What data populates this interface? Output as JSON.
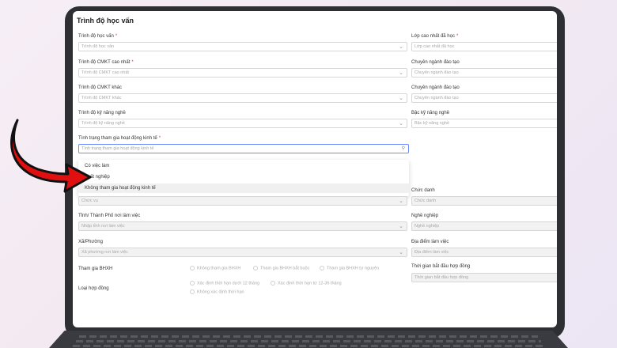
{
  "section_title": "Trình độ học vấn",
  "fields": {
    "trinh_do_hoc_van": {
      "label": "Trình độ học vấn",
      "placeholder": "Trình độ học vấn",
      "required": "*"
    },
    "lop_cao_nhat": {
      "label": "Lớp cao nhất đã học",
      "placeholder": "Lớp cao nhất đã học",
      "required": "*"
    },
    "cmkt_cao_nhat": {
      "label": "Trình độ CMKT cao nhất",
      "placeholder": "Trình độ CMKT cao nhất",
      "required": "*"
    },
    "chuyen_nganh_1": {
      "label": "Chuyên ngành đào tạo",
      "placeholder": "Chuyên ngành đào tạo"
    },
    "cmkt_khac": {
      "label": "Trình độ CMKT khác",
      "placeholder": "Trình độ CMKT khác"
    },
    "chuyen_nganh_2": {
      "label": "Chuyên ngành đào tạo",
      "placeholder": "Chuyên ngành đào tạo"
    },
    "ky_nang_nghe": {
      "label": "Trình độ kỹ năng nghề",
      "placeholder": "Trình độ kỹ năng nghề"
    },
    "bac_ky_nang": {
      "label": "Bậc kỹ năng nghề",
      "placeholder": "Bậc kỹ năng nghề"
    },
    "tinh_trang": {
      "label": "Tình trạng tham gia hoạt động kinh tế",
      "placeholder": "Tình trạng tham gia hoạt động kinh tế",
      "required": "*"
    },
    "chuc_vu": {
      "placeholder": "Chức vụ"
    },
    "chuc_danh": {
      "label": "Chức danh",
      "placeholder": "Chức danh"
    },
    "tinh_tp": {
      "label": "Tỉnh/ Thành Phố nơi làm việc",
      "placeholder": "Nhập tỉnh nơi làm việc"
    },
    "nghe_nghiep": {
      "label": "Nghề nghiệp",
      "placeholder": "Nghề nghiệp"
    },
    "xa_phuong": {
      "label": "Xã/Phường",
      "placeholder": "Xã phường nơi làm việc"
    },
    "dia_diem": {
      "label": "Địa điểm làm việc",
      "placeholder": "Địa điểm làm việc"
    },
    "tham_gia_bhxh": {
      "label": "Tham gia BHXH"
    },
    "thoi_gian_hd": {
      "label": "Thời gian bắt đầu hợp đồng",
      "placeholder": "Thời gian bắt đầu hợp đồng"
    },
    "loai_hd": {
      "label": "Loại hợp đồng"
    }
  },
  "dropdown_options": [
    "Có việc làm",
    "Thất nghiệp",
    "Không tham gia hoạt động kinh tế"
  ],
  "bhxh_options": [
    "Không tham gia BHXH",
    "Tham gia BHXH bắt buộc",
    "Tham gia BHXH tự nguyện"
  ],
  "hd_options": [
    "Xác định thời hạn dưới 12 tháng",
    "Xác định thời hạn từ 12-36 tháng",
    "Không xác định thời hạn"
  ],
  "colors": {
    "arrow": "#e01010",
    "required": "#d9363e",
    "frame": "#2e2f33"
  }
}
